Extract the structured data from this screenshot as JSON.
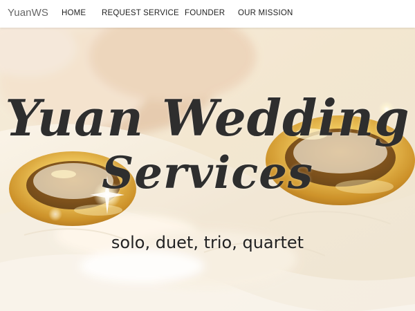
{
  "navbar": {
    "brand": "YuanWS",
    "links": [
      {
        "label": "HOME"
      },
      {
        "label": "REQUEST SERVICE"
      },
      {
        "label": "FOUNDER"
      },
      {
        "label": "OUR MISSION"
      }
    ]
  },
  "hero": {
    "title_line_1": "Yuan Wedding",
    "title_line_2": "Services",
    "tagline": "solo, duet, trio, quartet"
  },
  "colors": {
    "nav_background": "#ffffff",
    "brand_text": "#666666",
    "nav_text": "#222222",
    "hero_text": "#2e2e2e",
    "gold": "#c99326",
    "cream": "#f4ead8",
    "rose": "#ead6c0"
  },
  "icons": {
    "background_image": "wedding-rings-photo"
  }
}
